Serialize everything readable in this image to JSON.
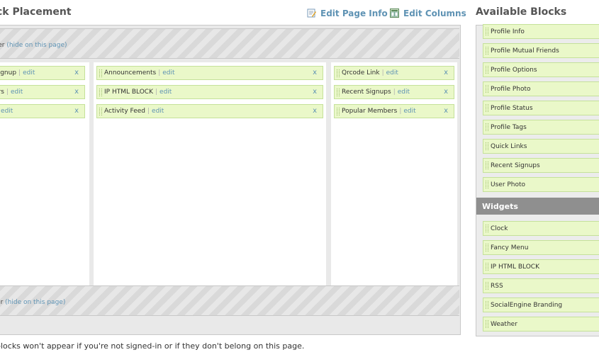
{
  "header": {
    "title": "ck Placement",
    "edit_page_info": "Edit Page Info",
    "edit_columns": "Edit Columns",
    "available_title": "Available Blocks"
  },
  "editor": {
    "header_band": {
      "label": "ader",
      "link": "(hide on this page)"
    },
    "footer_band": {
      "label": "oter",
      "link": "(hide on this page)"
    },
    "columns": [
      {
        "blocks": [
          {
            "name": "Signup",
            "edit": "edit",
            "remove": "x"
          },
          {
            "name": "ers",
            "edit": "edit",
            "remove": "x"
          },
          {
            "name": "",
            "edit": "edit",
            "remove": "x"
          }
        ]
      },
      {
        "blocks": [
          {
            "name": "Announcements",
            "edit": "edit",
            "remove": "x"
          },
          {
            "name": "IP HTML BLOCK",
            "edit": "edit",
            "remove": "x"
          },
          {
            "name": "Activity Feed",
            "edit": "edit",
            "remove": "x"
          }
        ]
      },
      {
        "blocks": [
          {
            "name": "Qrcode Link",
            "edit": "edit",
            "remove": "x"
          },
          {
            "name": "Recent Signups",
            "edit": "edit",
            "remove": "x"
          },
          {
            "name": "Popular Members",
            "edit": "edit",
            "remove": "x"
          }
        ]
      }
    ]
  },
  "note": "blocks won't appear if you're not signed-in or if they don't belong on this page.",
  "available": {
    "profile_items": [
      "Profile Info",
      "Profile Mutual Friends",
      "Profile Options",
      "Profile Photo",
      "Profile Status",
      "Profile Tags",
      "Quick Links",
      "Recent Signups",
      "User Photo"
    ],
    "widgets_label": "Widgets",
    "widget_items": [
      "Clock",
      "Fancy Menu",
      "IP HTML BLOCK",
      "RSS",
      "SocialEngine Branding",
      "Weather"
    ]
  }
}
